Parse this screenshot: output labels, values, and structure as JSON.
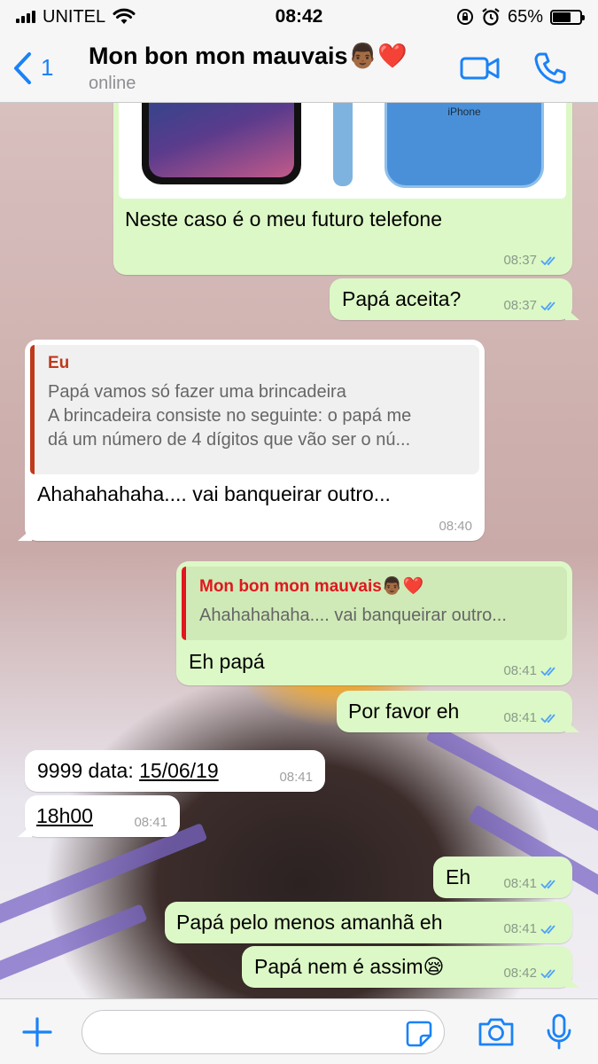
{
  "status_bar": {
    "carrier": "UNITEL",
    "time": "08:42",
    "battery_percent": "65%"
  },
  "header": {
    "back_count": "1",
    "contact_name": "Mon bon mon mauvais👨🏾❤️",
    "status": "online"
  },
  "messages": {
    "m1": {
      "text": "Neste caso é o meu futuro telefone",
      "time": "08:37",
      "image_label": "iPhone"
    },
    "m2": {
      "text": "Papá aceita?",
      "time": "08:37"
    },
    "m3": {
      "quote_author": "Eu",
      "quote_line1": "Papá vamos só fazer uma brincadeira",
      "quote_line2": "A brincadeira consiste no seguinte: o papá me",
      "quote_line3": "dá um número de 4 dígitos que vão ser o nú...",
      "text": "Ahahahahaha.... vai banqueirar outro...",
      "time": "08:40"
    },
    "m4": {
      "quote_author": "Mon bon mon mauvais👨🏾❤️",
      "quote_text": "Ahahahahaha.... vai banqueirar outro...",
      "text": "Eh papá",
      "time": "08:41"
    },
    "m5": {
      "text": "Por favor eh",
      "time": "08:41"
    },
    "m6": {
      "text_prefix": "9999 data: ",
      "date_link": "15/06/19",
      "time": "08:41"
    },
    "m7": {
      "link": "18h00",
      "time": "08:41"
    },
    "m8": {
      "text": "Eh",
      "time": "08:41"
    },
    "m9": {
      "text": "Papá pelo menos amanhã eh",
      "time": "08:41"
    },
    "m10": {
      "text": "Papá nem é assim😪",
      "time": "08:42"
    }
  },
  "colors": {
    "accent": "#1a82f7",
    "outgoing_bubble": "#dcf8c6",
    "incoming_bubble": "#ffffff",
    "read_ticks": "#4fa3f7"
  }
}
